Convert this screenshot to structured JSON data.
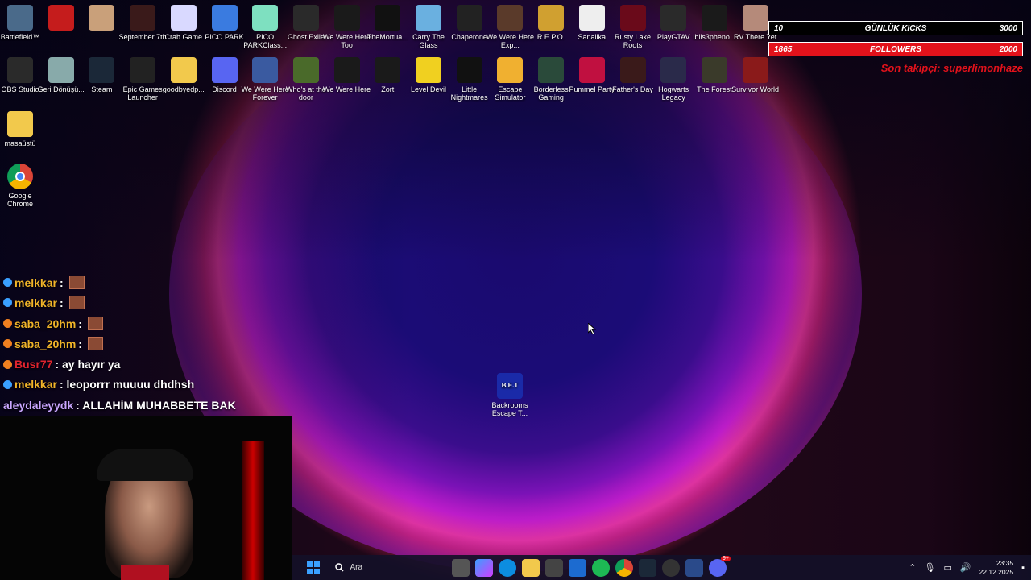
{
  "desktop": {
    "icons_row1": [
      "Battlefield™",
      "",
      "",
      "September 7th",
      "Crab Game",
      "PICO PARK",
      "PICO PARKClass...",
      "Ghost Exile",
      "We Were Here Too",
      "TheMortua...",
      "Carry The Glass",
      "Chaperone",
      "We Were Here Exp...",
      "R.E.P.O.",
      "Sanalika",
      "Rusty Lake Roots",
      "PlayGTAV",
      "iblis3pheno...",
      "RV There Yet"
    ],
    "icons_row2": [
      "OBS Studio",
      "Geri Dönüşü...",
      "Steam",
      "Epic Games Launcher",
      "goodbyedp...",
      "Discord",
      "We Were Here Forever",
      "Who's at the door",
      "We Were Here",
      "Zort",
      "Level Devil",
      "Little Nightmares",
      "Escape Simulator",
      "Borderless Gaming",
      "Pummel Party",
      "Father's Day",
      "Hogwarts Legacy",
      "The Forest",
      "Survivor World"
    ],
    "icons_col": [
      "masaüstü",
      "Google Chrome"
    ],
    "center_icon": "Backrooms Escape T..."
  },
  "hud": {
    "kicks_left": "10",
    "kicks_label": "GÜNLÜK KICKS",
    "kicks_right": "3000",
    "followers_left": "1865",
    "followers_label": "FOLLOWERS",
    "followers_right": "2000",
    "last_follower": "Son takipçi: superlimonhaze"
  },
  "chat": [
    {
      "user": "melkkar",
      "text": ":",
      "color": "#f0b429"
    },
    {
      "user": "melkkar",
      "text": ":",
      "color": "#f0b429"
    },
    {
      "user": "saba_20hm",
      "text": ":",
      "color": "#f0b429"
    },
    {
      "user": "saba_20hm",
      "text": ":",
      "color": "#f0b429"
    },
    {
      "user": "Busr77",
      "text": ": ay hayır ya",
      "color": "#e0242f"
    },
    {
      "user": "melkkar",
      "text": ": leoporrr muuuu dhdhsh",
      "color": "#f0b429"
    },
    {
      "user": "aleydaleyydk",
      "text": ": ALLAHİM MUHABBETE BAK",
      "color": "#c9a6ff"
    }
  ],
  "taskbar": {
    "search_placeholder": "Ara",
    "time": "23:35",
    "date": "22.12.2025",
    "discord_badge": "9+"
  }
}
